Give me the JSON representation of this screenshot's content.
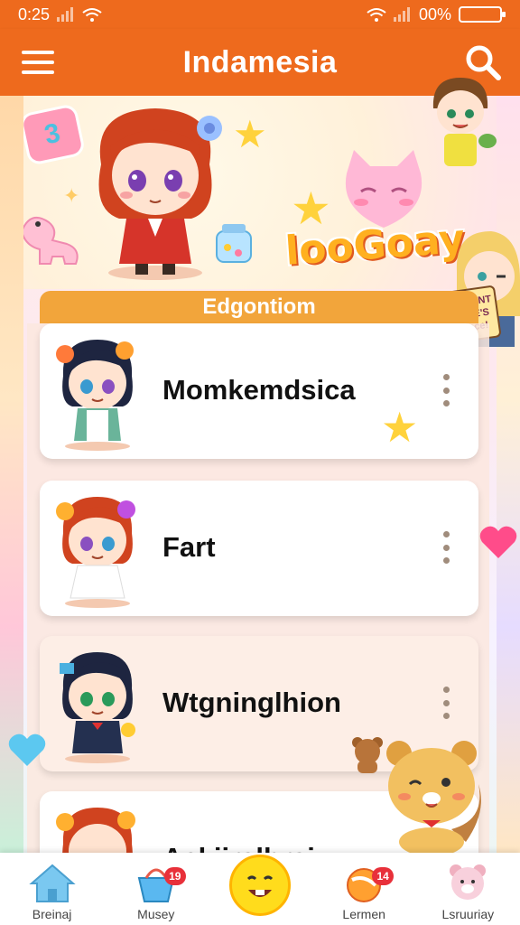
{
  "status_bar": {
    "time": "0:25",
    "battery": "00%"
  },
  "app_bar": {
    "title": "Indamesia"
  },
  "banner": {
    "badge_text": "3",
    "logo_text": "looGoay"
  },
  "side_sign": {
    "line1": "REHMIONT",
    "line2": "DISTRE'S",
    "line3": "Peciace!"
  },
  "section": {
    "title": "Edgontiom"
  },
  "list": {
    "items": [
      {
        "name": "Momkemdsica"
      },
      {
        "name": "Fart"
      },
      {
        "name": "Wtgninglhion"
      },
      {
        "name": "Ackiiralhrai"
      }
    ]
  },
  "bottom_nav": {
    "items": [
      {
        "label": "Breinaj",
        "icon": "home-icon",
        "badge": ""
      },
      {
        "label": "Musey",
        "icon": "basket-icon",
        "badge": "19"
      },
      {
        "label": "",
        "icon": "smiley-icon",
        "badge": ""
      },
      {
        "label": "Lermen",
        "icon": "candy-icon",
        "badge": "14"
      },
      {
        "label": "Lsruuriay",
        "icon": "teddy-icon",
        "badge": ""
      }
    ]
  },
  "colors": {
    "brand": "#ee6a1d",
    "section": "#f2a53b",
    "badge": "#e8303a"
  }
}
